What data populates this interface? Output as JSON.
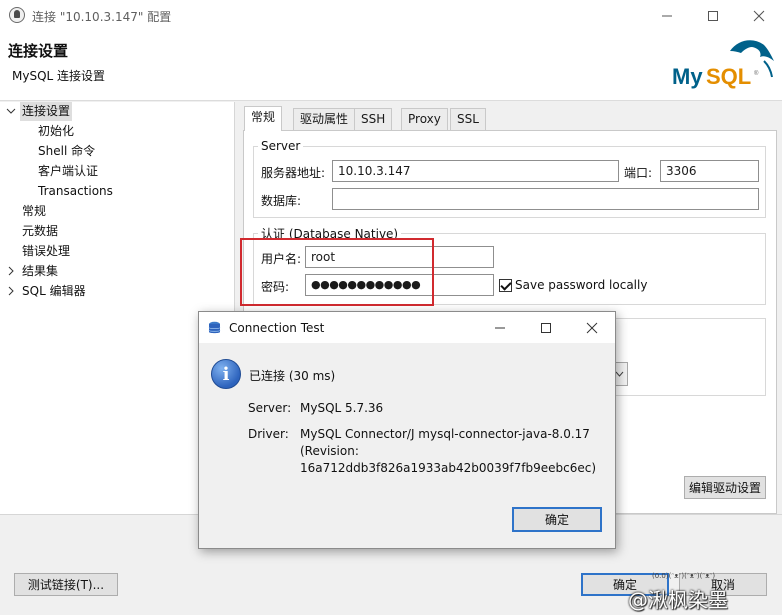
{
  "window": {
    "title": "连接 \"10.10.3.147\" 配置"
  },
  "header": {
    "title": "连接设置",
    "subtitle": "MySQL 连接设置",
    "logo_text": "MySQL"
  },
  "sidebar": {
    "items": [
      {
        "label": "连接设置",
        "expanded": true,
        "selected": true
      },
      {
        "label": "初始化"
      },
      {
        "label": "Shell 命令"
      },
      {
        "label": "客户端认证"
      },
      {
        "label": "Transactions"
      },
      {
        "label": "常规"
      },
      {
        "label": "元数据"
      },
      {
        "label": "错误处理"
      },
      {
        "label": "结果集",
        "expandable": true
      },
      {
        "label": "SQL 编辑器",
        "expandable": true
      }
    ]
  },
  "tabs": [
    "常规",
    "驱动属性",
    "SSH",
    "Proxy",
    "SSL"
  ],
  "server": {
    "group_title": "Server",
    "host_label": "服务器地址:",
    "host_value": "10.10.3.147",
    "port_label": "端口:",
    "port_value": "3306",
    "db_label": "数据库:",
    "db_value": ""
  },
  "auth": {
    "group_title": "认证 (Database Native)",
    "user_label": "用户名:",
    "user_value": "root",
    "password_label": "密码:",
    "password_value": "●●●●●●●●●●●●",
    "save_password_label": "Save password locally",
    "save_password_checked": true
  },
  "buttons": {
    "edit_driver": "编辑驱动设置",
    "test_connection": "测试链接(T)...",
    "ok": "确定",
    "cancel": "取消"
  },
  "dialog": {
    "title": "Connection Test",
    "status": "已连接 (30 ms)",
    "server_label": "Server:",
    "server_value": "MySQL 5.7.36",
    "driver_label": "Driver:",
    "driver_line1": "MySQL Connector/J mysql-connector-java-8.0.17",
    "driver_line2": "(Revision:",
    "driver_line3": "16a712ddb3f826a1933ab42b0039f7fb9eebc6ec)",
    "ok_label": "确定"
  },
  "watermark": {
    "line1": "(0.0)(ᵔᴥᵔ)(ᵔᴥᵔ)(ᵔᴥᵔ)",
    "line2": "@湫枫染墨"
  },
  "colors": {
    "highlight_box": "#d12a2f",
    "primary_button_border": "#2e73c9",
    "mysql_blue": "#00618a",
    "mysql_orange": "#e48e00",
    "info_icon": "#2d63bd"
  }
}
